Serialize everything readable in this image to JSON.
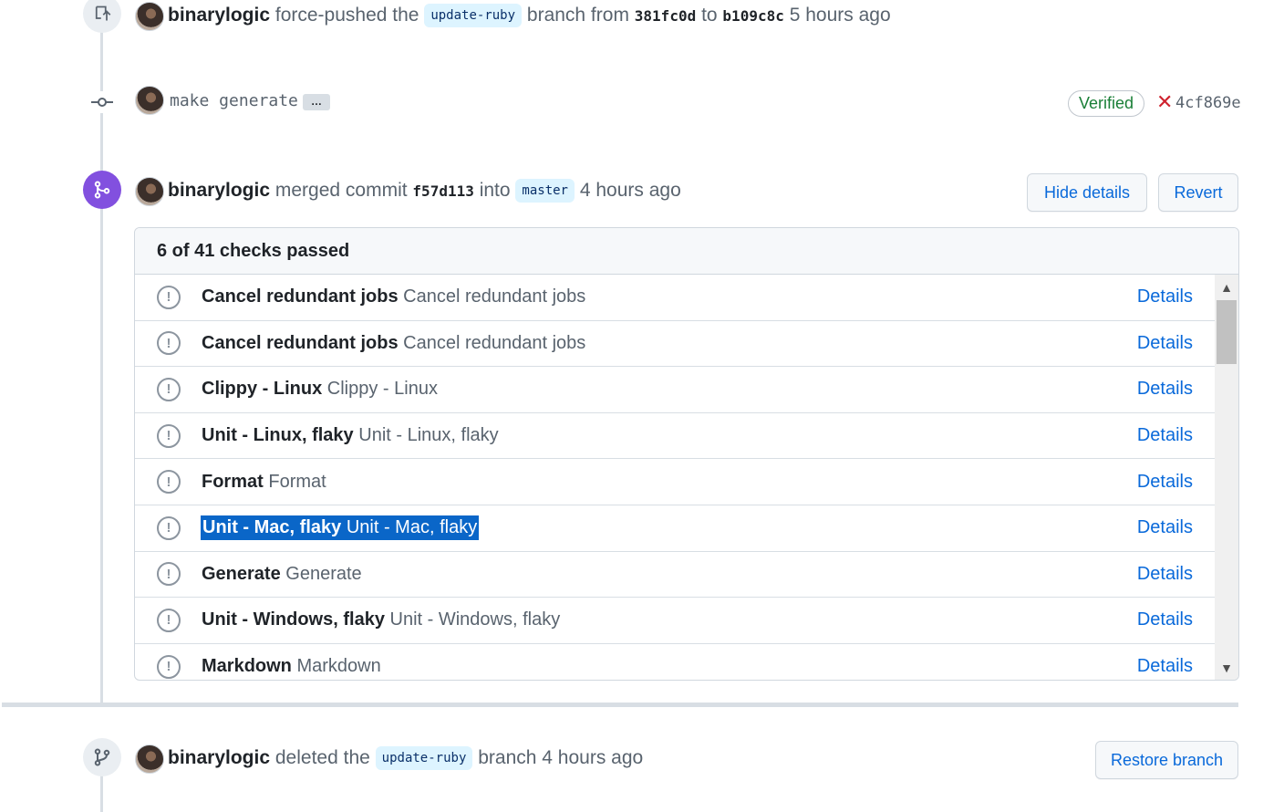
{
  "events": {
    "force_push": {
      "author": "binarylogic",
      "action": "force-pushed the",
      "branch": "update-ruby",
      "mid": "branch from",
      "from_sha": "381fc0d",
      "to": "to",
      "to_sha": "b109c8c",
      "time": "5 hours ago"
    },
    "commit": {
      "message": "make generate",
      "ellipsis": "…",
      "verified_label": "Verified",
      "status_icon": "x-icon",
      "sha": "4cf869e"
    },
    "merge": {
      "author": "binarylogic",
      "action": "merged commit",
      "sha": "f57d113",
      "into": "into",
      "branch": "master",
      "time": "4 hours ago",
      "hide_details_label": "Hide details",
      "revert_label": "Revert"
    },
    "delete": {
      "author": "binarylogic",
      "action": "deleted the",
      "branch": "update-ruby",
      "suffix": "branch",
      "time": "4 hours ago",
      "restore_label": "Restore branch"
    }
  },
  "checks": {
    "summary": "6 of 41 checks passed",
    "details_label": "Details",
    "items": [
      {
        "name": "Cancel redundant jobs",
        "desc": "Cancel redundant jobs"
      },
      {
        "name": "Cancel redundant jobs",
        "desc": "Cancel redundant jobs"
      },
      {
        "name": "Clippy - Linux",
        "desc": "Clippy - Linux"
      },
      {
        "name": "Unit - Linux, flaky",
        "desc": "Unit - Linux, flaky"
      },
      {
        "name": "Format",
        "desc": "Format"
      },
      {
        "name": "Unit - Mac, flaky",
        "desc": "Unit - Mac, flaky"
      },
      {
        "name": "Generate",
        "desc": "Generate"
      },
      {
        "name": "Unit - Windows, flaky",
        "desc": "Unit - Windows, flaky"
      },
      {
        "name": "Markdown",
        "desc": "Markdown"
      }
    ]
  },
  "colors": {
    "accent": "#0969da",
    "merged": "#8250df",
    "verified": "#1a7f37",
    "failure": "#cf222e",
    "selection": "#0a66c8"
  }
}
